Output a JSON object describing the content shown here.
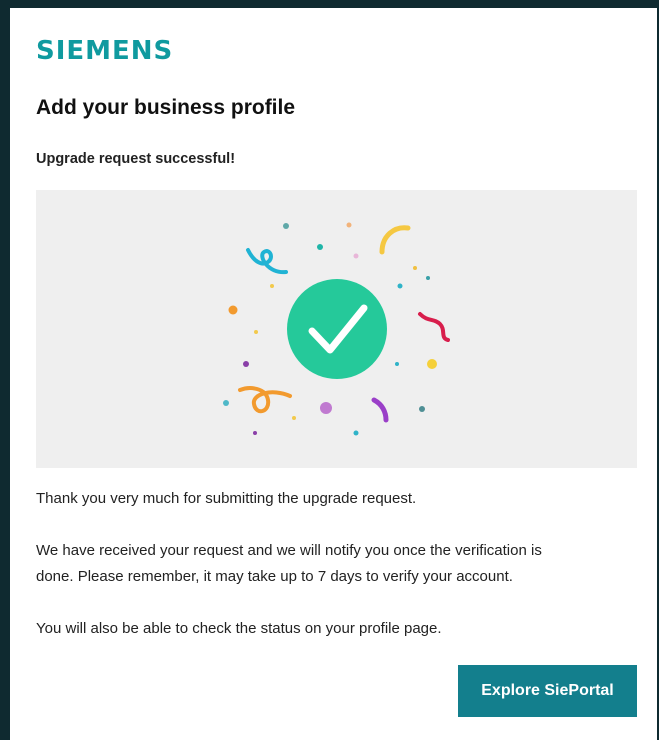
{
  "brand": {
    "logo_text": "SIEMENS",
    "color": "#0f9a9f"
  },
  "page": {
    "title": "Add your business profile",
    "status_message": "Upgrade request successful!"
  },
  "illustration": {
    "icon": "checkmark-circle-icon",
    "decoration": "confetti",
    "check_color": "#25c99a",
    "background": "#efefef"
  },
  "body": {
    "paragraph1": "Thank you very much for submitting the upgrade request.",
    "paragraph2_line1": "We have received your request and we will notify you once the verification is",
    "paragraph2_line2": "done. Please remember, it may take up to 7 days to verify your account.",
    "paragraph3": "You will also be able to check the status on your profile page."
  },
  "actions": {
    "explore_label": "Explore SiePortal",
    "button_color": "#137f8d"
  }
}
